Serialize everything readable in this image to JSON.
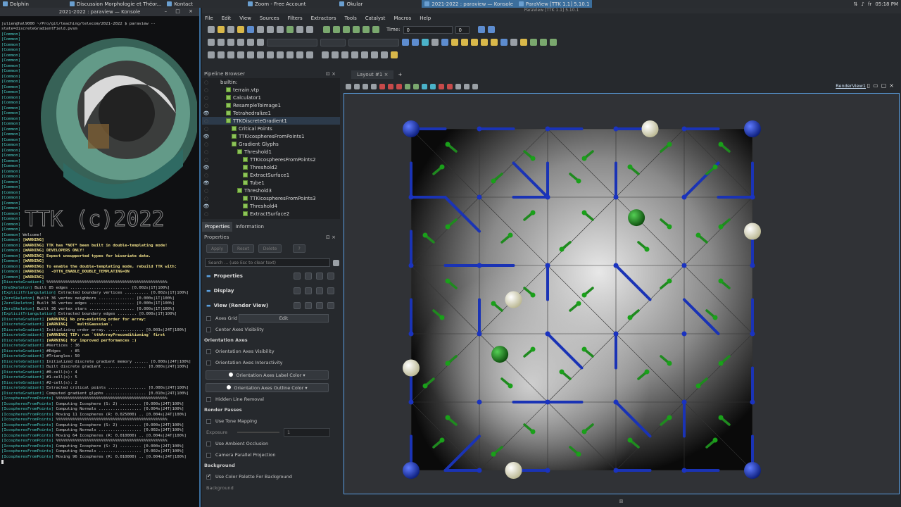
{
  "taskbar": {
    "tasks": [
      "Dolphin",
      "Discussion Morphologie et Théor...",
      "Kontact",
      "Zoom - Free Account",
      "Okular",
      "2021-2022 : paraview — Konsole",
      "ParaView [TTK 1.1] 5.10.1"
    ],
    "clock": "05:18 PM",
    "lang": "fr"
  },
  "konsole": {
    "title": "2021-2022 : paraview — Konsole",
    "prompt": "julien@hal9000 ~/Pro/git/teaching/telecom/2021-2022 $ paraview --state=discreteGradientField.pvsm",
    "common_prefix": "[Common]",
    "lines": [
      "[Common] Welcome!",
      "[Common] [WARNING]",
      "[Common] [WARNING] TTK has *NOT* been built in double-templating mode!",
      "[Common] [WARNING] DEVELOPERS ONLY!",
      "[Common] [WARNING] Expect unsupported types for bivariate data.",
      "[Common] [WARNING]",
      "[Common] [WARNING] To enable the double-templating mode, rebuild TTK with:",
      "[Common] [WARNING]   -DTTK_ENABLE_DOUBLE_TEMPLATING=ON",
      "[Common] [WARNING]",
      "[DiscreteGradient] %%%%%%%%%%%%%%%%%%%%%%%%%%%%%%%%%%%%%%%%%%%%%%%%%%%",
      "[OneSkeleton] Built 85 edges ......................... [0.002s|1T|100%]",
      "[ExplicitTriangulation] Extracted boundary vertices .......... [0.002s|1T|100%]",
      "[ZeroSkeleton] Built 36 vertex neighbors ............... [0.000s|1T|100%]",
      "[ZeroSkeleton] Built 36 vertex edges ................... [0.000s|1T|100%]",
      "[ZeroSkeleton] Built 36 vertex stars ................... [0.000s|1T|100%]",
      "[ExplicitTriangulation] Extracted boundary edges ........ [0.000s|1T|100%]",
      "[DiscreteGradient] [WARNING] No pre-existing order for array:",
      "[DiscreteGradient] [WARNING]   `multiGaussian`.",
      "[DiscreteGradient] Initializing order array. ............... [0.003s|24T|100%]",
      "[DiscreteGradient] [WARNING] TIP: run `ttkArrayPreconditioning` first",
      "[DiscreteGradient] [WARNING] for improved performances :)",
      "[DiscreteGradient] #Vertices : 36",
      "[DiscreteGradient] #Edges    : 85",
      "[DiscreteGradient] #Triangles: 50",
      "[DiscreteGradient] Initialized discrete gradient memory ...... [0.000s|24T|100%]",
      "[DiscreteGradient] Built discrete gradient .................. [0.000s|24T|100%]",
      "[DiscreteGradient] #0-cell(s): 4",
      "[DiscreteGradient] #1-cell(s): 5",
      "[DiscreteGradient] #2-cell(s): 2",
      "[DiscreteGradient] Extracted critical points ................ [0.000s|24T|100%]",
      "[DiscreteGradient] Computed gradient glyphs ................. [0.010s|24T|100%]",
      "[IcospheresFromPoints] %%%%%%%%%%%%%%%%%%%%%%%%%%%%%%%%%%%%%%%%%%%%%%%",
      "[IcospheresFromPoints] Computing Icosphere (S: 2) ......... [0.000s|24T|100%]",
      "[IcospheresFromPoints] Computing Normals .................. [0.004s|24T|100%]",
      "[IcospheresFromPoints] Moving 11 Icospheres (R: 0.025000) .. [0.004s|24T|100%]",
      "[IcospheresFromPoints] %%%%%%%%%%%%%%%%%%%%%%%%%%%%%%%%%%%%%%%%%%%%%%%",
      "[IcospheresFromPoints] Computing Icosphere (S: 2) ......... [0.000s|24T|100%]",
      "[IcospheresFromPoints] Computing Normals .................. [0.002s|24T|100%]",
      "[IcospheresFromPoints] Moving 64 Icospheres (R: 0.010000) .. [0.004s|24T|100%]",
      "[IcospheresFromPoints] %%%%%%%%%%%%%%%%%%%%%%%%%%%%%%%%%%%%%%%%%%%%%%%",
      "[IcospheresFromPoints] Computing Icosphere (S: 2) ......... [0.000s|24T|100%]",
      "[IcospheresFromPoints] Computing Normals .................. [0.002s|24T|100%]",
      "[IcospheresFromPoints] Moving 96 Icospheres (R: 0.010000) .. [0.004s|24T|100%]"
    ]
  },
  "paraview": {
    "title": "ParaView [TTK 1.1] 5.10.1",
    "menu": [
      "File",
      "Edit",
      "View",
      "Sources",
      "Filters",
      "Extractors",
      "Tools",
      "Catalyst",
      "Macros",
      "Help"
    ],
    "time_label": "Time:",
    "time_value": "0",
    "time_step": "0",
    "pipeline_title": "Pipeline Browser",
    "pipeline": [
      {
        "label": "builtin:",
        "indent": 0,
        "eye": false
      },
      {
        "label": "terrain.vtp",
        "indent": 1,
        "eye": false
      },
      {
        "label": "Calculator1",
        "indent": 1,
        "eye": false
      },
      {
        "label": "ResampleToImage1",
        "indent": 1,
        "eye": false
      },
      {
        "label": "Tetrahedralize1",
        "indent": 1,
        "eye": true
      },
      {
        "label": "TTKDiscreteGradient1",
        "indent": 1,
        "eye": false
      },
      {
        "label": "Critical Points",
        "indent": 2,
        "eye": false
      },
      {
        "label": "TTKIcospheresFromPoints1",
        "indent": 2,
        "eye": true
      },
      {
        "label": "Gradient Glyphs",
        "indent": 2,
        "eye": false
      },
      {
        "label": "Threshold1",
        "indent": 3,
        "eye": false
      },
      {
        "label": "TTKIcospheresFromPoints2",
        "indent": 4,
        "eye": false
      },
      {
        "label": "Threshold2",
        "indent": 4,
        "eye": true
      },
      {
        "label": "ExtractSurface1",
        "indent": 4,
        "eye": false
      },
      {
        "label": "Tube1",
        "indent": 4,
        "eye": true
      },
      {
        "label": "Threshold3",
        "indent": 3,
        "eye": false
      },
      {
        "label": "TTKIcospheresFromPoints3",
        "indent": 4,
        "eye": false
      },
      {
        "label": "Threshold4",
        "indent": 4,
        "eye": true
      },
      {
        "label": "ExtractSurface2",
        "indent": 4,
        "eye": false
      }
    ],
    "tabs": [
      "Properties",
      "Information"
    ],
    "properties_title": "Properties",
    "buttons": {
      "apply": "Apply",
      "reset": "Reset",
      "delete": "Delete",
      "help": "?"
    },
    "search_placeholder": "Search ... (use Esc to clear text)",
    "sections": [
      "Properties",
      "Display",
      "View (Render View)"
    ],
    "axes_grid": "Axes Grid",
    "edit": "Edit",
    "center_axes_visibility": "Center Axes Visibility",
    "orientation_axes": "Orientation Axes",
    "orientation_axes_visibility": "Orientation Axes Visibility",
    "orientation_axes_interactivity": "Orientation Axes Interactivity",
    "orientation_axes_label_color": "Orientation Axes Label Color",
    "orientation_axes_outline_color": "Orientation Axes Outline Color",
    "hidden_line_removal": "Hidden Line Removal",
    "render_passes": "Render Passes",
    "use_tone_mapping": "Use Tone Mapping",
    "exposure": "Exposure",
    "exposure_value": "1",
    "use_ambient_occlusion": "Use Ambient Occlusion",
    "camera_parallel_projection": "Camera Parallel Projection",
    "background": "Background",
    "use_color_palette": "Use Color Palette For Background",
    "background2": "Background",
    "layout_tab": "Layout #1",
    "render_view_label": "RenderView1",
    "colors": {
      "accent": "#3b6e9c",
      "min_sphere": "#1a3db0",
      "saddle_sphere": "#1e7a1e",
      "max_sphere": "#e8e6c8",
      "glyph_blue": "#1a33b5",
      "glyph_green": "#1f8a1f"
    }
  }
}
